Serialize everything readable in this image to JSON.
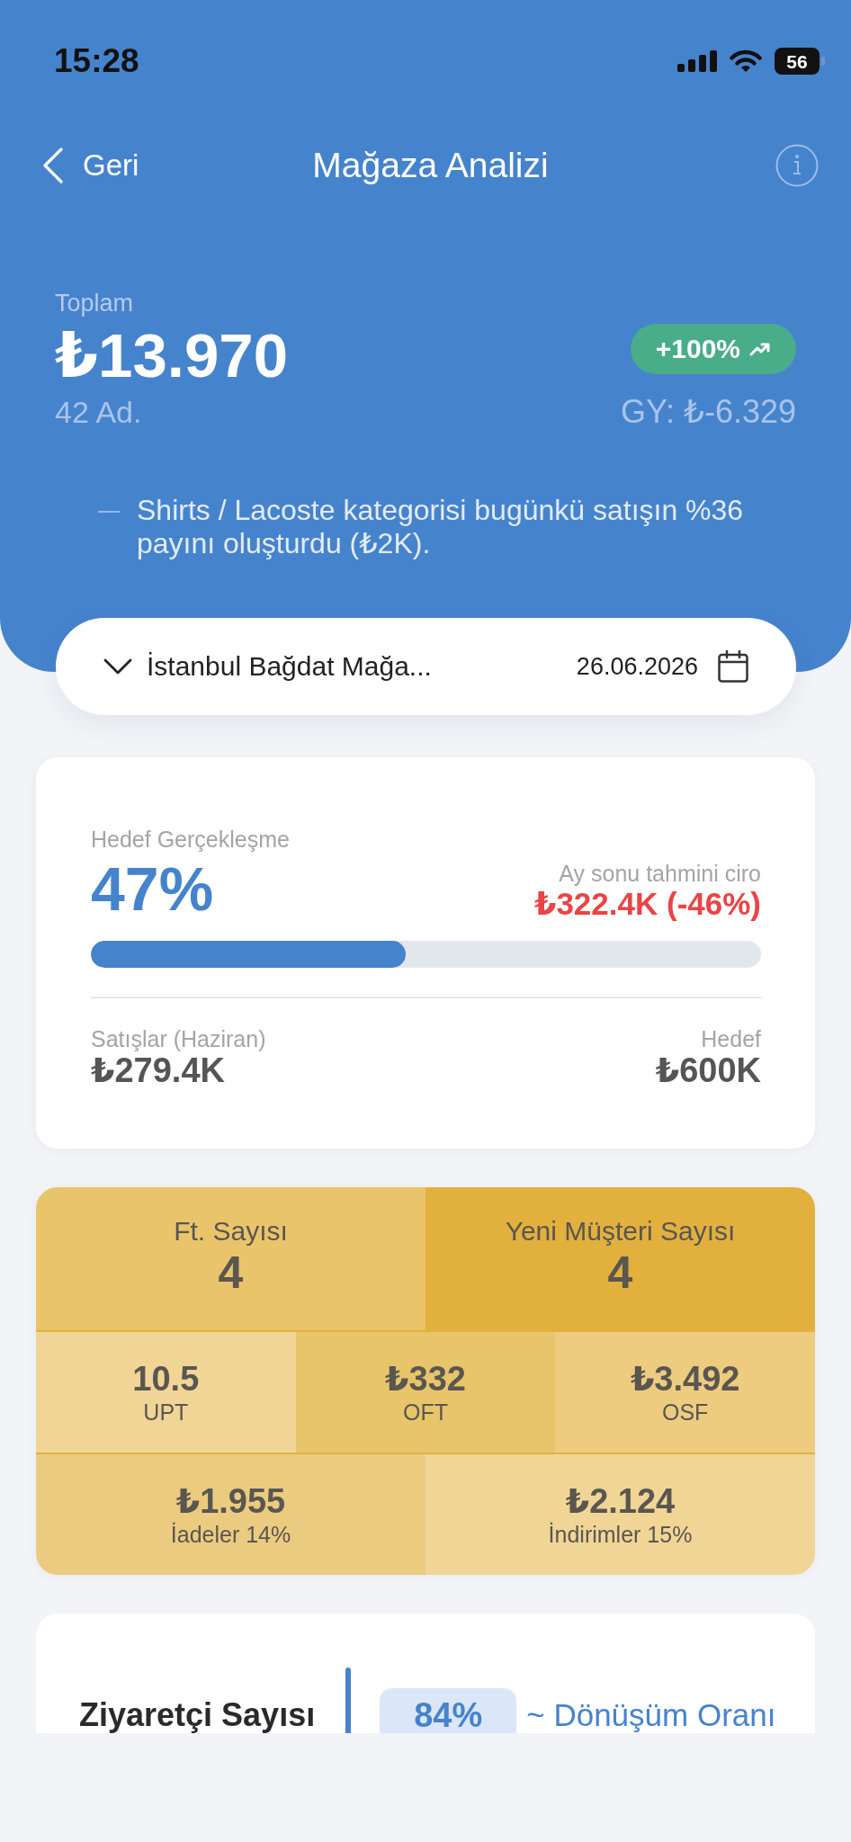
{
  "status_bar": {
    "time": "15:28",
    "battery": "56"
  },
  "nav": {
    "back": "Geri",
    "title": "Mağaza Analizi"
  },
  "summary": {
    "label": "Toplam",
    "total": "₺13.970",
    "quantity": "42 Ad.",
    "change": "+100%",
    "previous": "GY: ₺-6.329"
  },
  "insight": "Shirts / Lacoste kategorisi bugünkü satışın %36 payını oluşturdu (₺2K).",
  "selector": {
    "store": "İstanbul Bağdat Mağa...",
    "date": "26.06.2026"
  },
  "target": {
    "label": "Hedef Gerçekleşme",
    "percent": "47%",
    "forecast_label": "Ay sonu tahmini ciro",
    "forecast": "₺322.4K (-46%)",
    "level": 0.47,
    "sales_label": "Satışlar (Haziran)",
    "sales": "₺279.4K",
    "goal_label": "Hedef",
    "goal": "₺600K"
  },
  "metrics": [
    {
      "kind": "header",
      "cells": [
        {
          "label": "Ft. Sayısı",
          "value": "4",
          "color": "#e9c46b"
        },
        {
          "label": "Yeni Müşteri Sayısı",
          "value": "4",
          "color": "#e2b03d"
        }
      ]
    },
    {
      "kind": "stat",
      "cells": [
        {
          "value": "10.5",
          "label": "UPT",
          "color": "#f0d596"
        },
        {
          "value": "₺332",
          "label": "OFT",
          "color": "#e8c46b"
        },
        {
          "value": "₺3.492",
          "label": "OSF",
          "color": "#edcc80"
        }
      ]
    },
    {
      "kind": "stat",
      "cells": [
        {
          "value": "₺1.955",
          "label": "İadeler 14%",
          "color": "#ebcb80"
        },
        {
          "value": "₺2.124",
          "label": "İndirimler 15%",
          "color": "#f0d596"
        }
      ]
    }
  ],
  "visitors": {
    "label": "Ziyaretçi Sayısı",
    "rate": "84%",
    "rate_label": "~ Dönüşüm Oranı"
  }
}
